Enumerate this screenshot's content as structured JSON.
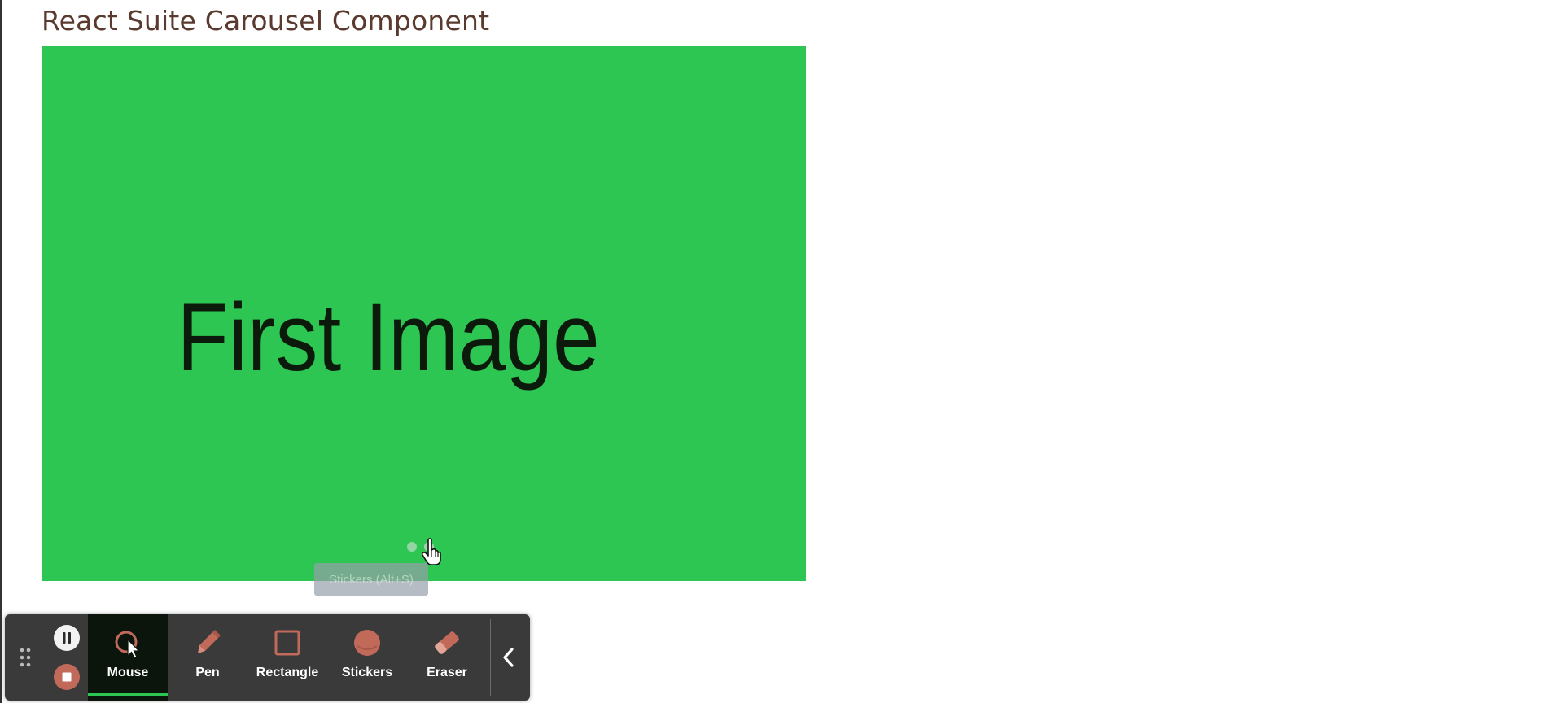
{
  "page": {
    "title": "React Suite Carousel Component"
  },
  "carousel": {
    "slide_text": "First Image",
    "background": "#2dc653",
    "active_index": 1,
    "slide_count": 2
  },
  "tooltip": {
    "text": "Stickers (Alt+S)"
  },
  "toolbar": {
    "tools": [
      {
        "label": "Mouse",
        "icon": "mouse-cursor-icon",
        "active": true
      },
      {
        "label": "Pen",
        "icon": "pen-icon",
        "active": false
      },
      {
        "label": "Rectangle",
        "icon": "rectangle-icon",
        "active": false
      },
      {
        "label": "Stickers",
        "icon": "sticker-icon",
        "active": false
      },
      {
        "label": "Eraser",
        "icon": "eraser-icon",
        "active": false
      }
    ],
    "accent_color": "#2dc653",
    "icon_color": "#c26a5a"
  }
}
